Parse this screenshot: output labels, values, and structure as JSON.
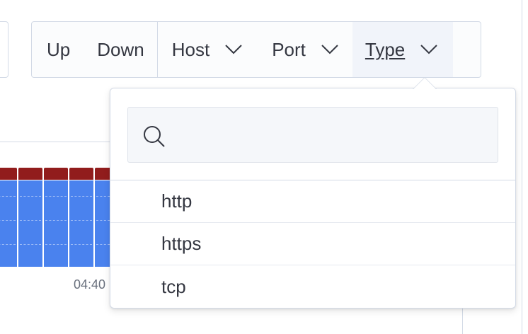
{
  "filter_group": {
    "up_label": "Up",
    "down_label": "Down",
    "host_label": "Host",
    "port_label": "Port",
    "type_label": "Type"
  },
  "type_popover": {
    "search_placeholder": "",
    "options": [
      "http",
      "https",
      "tcp"
    ]
  },
  "chart": {
    "x_tick_label": "04:40",
    "colors": {
      "up": "#4a82ee",
      "down": "#911c1c"
    }
  }
}
